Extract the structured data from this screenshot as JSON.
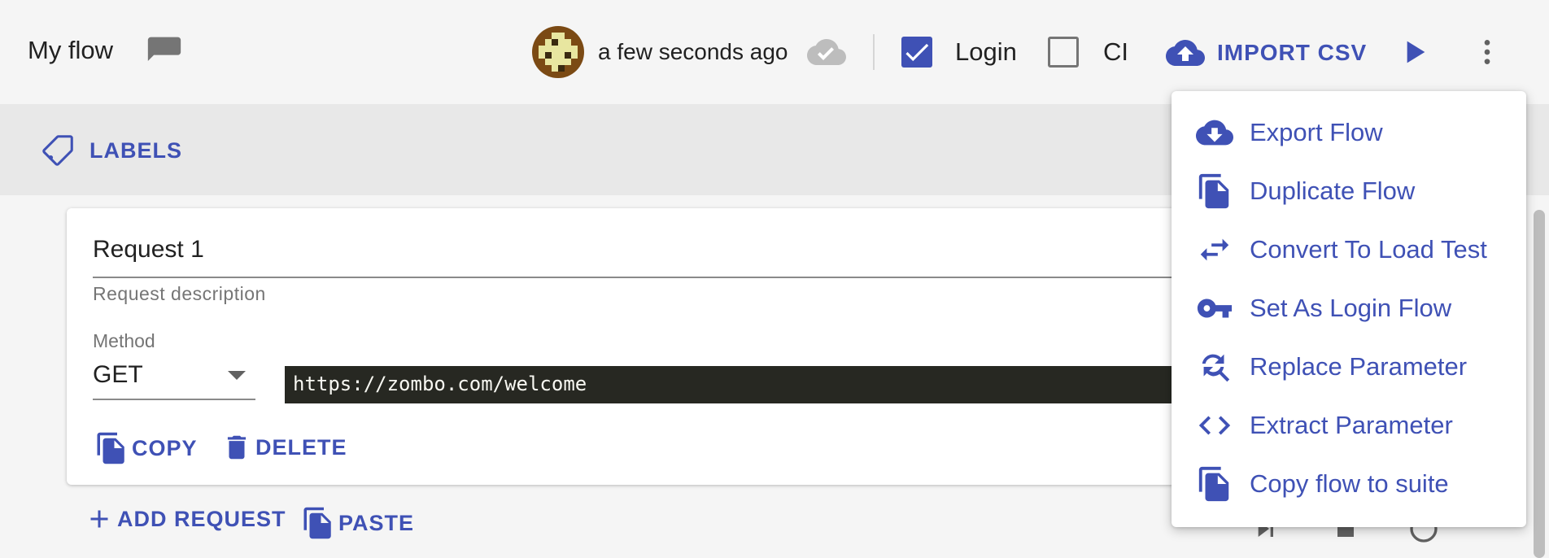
{
  "header": {
    "flow_title": "My flow",
    "saved_time": "a few seconds ago",
    "login_label": "Login",
    "login_checked": true,
    "ci_label": "CI",
    "ci_checked": false,
    "import_csv_label": "IMPORT CSV"
  },
  "labels_bar": {
    "labels_button": "LABELS"
  },
  "request_card": {
    "name": "Request 1",
    "description_placeholder": "Request description",
    "method_label": "Method",
    "method_value": "GET",
    "url": "https://zombo.com/welcome",
    "copy_label": "COPY",
    "delete_label": "DELETE"
  },
  "bottom_actions": {
    "add_request_label": "ADD REQUEST",
    "paste_label": "PASTE"
  },
  "menu": {
    "items": [
      {
        "label": "Export Flow",
        "icon": "cloud-download-icon"
      },
      {
        "label": "Duplicate Flow",
        "icon": "file-copy-icon"
      },
      {
        "label": "Convert To Load Test",
        "icon": "swap-arrows-icon"
      },
      {
        "label": "Set As Login Flow",
        "icon": "key-icon"
      },
      {
        "label": "Replace Parameter",
        "icon": "find-replace-icon"
      },
      {
        "label": "Extract Parameter",
        "icon": "code-icon"
      },
      {
        "label": "Copy flow to suite",
        "icon": "file-copy-icon"
      }
    ]
  },
  "colors": {
    "accent": "#3f51b5",
    "header_bg": "#f5f5f5",
    "labels_bar_bg": "#e8e8e8",
    "url_bg": "#272822"
  }
}
